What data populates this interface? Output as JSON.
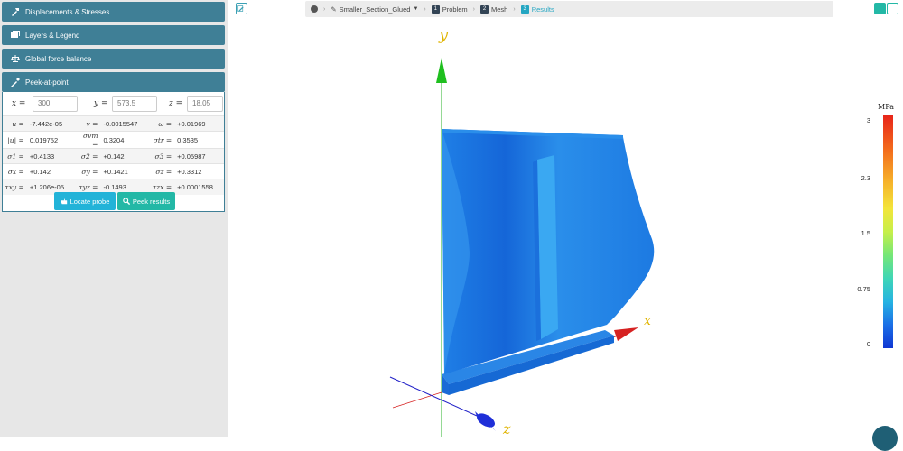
{
  "sidebar": {
    "panels": [
      {
        "label": "Displacements & Stresses",
        "icon": "hammer-icon"
      },
      {
        "label": "Layers & Legend",
        "icon": "image-icon"
      },
      {
        "label": "Global force balance",
        "icon": "scale-icon"
      },
      {
        "label": "Peek-at-point",
        "icon": "eyedropper-icon"
      }
    ],
    "peek": {
      "x_label": "x =",
      "x_value": "300",
      "y_label": "y =",
      "y_value": "573.5",
      "z_label": "z =",
      "z_value": "18.05",
      "rows": [
        [
          [
            "u =",
            "-7.442e-05"
          ],
          [
            "v =",
            "-0.0015547"
          ],
          [
            "ω =",
            "+0.01969"
          ]
        ],
        [
          [
            "|u| =",
            "0.019752"
          ],
          [
            "σvm =",
            "0.3204"
          ],
          [
            "σtr =",
            "0.3535"
          ]
        ],
        [
          [
            "σ1 =",
            "+0.4133"
          ],
          [
            "σ2 =",
            "+0.142"
          ],
          [
            "σ3 =",
            "+0.05987"
          ]
        ],
        [
          [
            "σx =",
            "+0.142"
          ],
          [
            "σy =",
            "+0.1421"
          ],
          [
            "σz =",
            "+0.3312"
          ]
        ],
        [
          [
            "τxy =",
            "+1.206e-05"
          ],
          [
            "τyz =",
            "-0.1493"
          ],
          [
            "τzx =",
            "+0.0001558"
          ]
        ]
      ],
      "locate_label": "Locate probe",
      "peek_label": "Peek results"
    }
  },
  "breadcrumb": {
    "project": "Smaller_Section_Glued",
    "steps": [
      {
        "num": "1",
        "label": "Problem"
      },
      {
        "num": "2",
        "label": "Mesh"
      },
      {
        "num": "3",
        "label": "Results"
      }
    ]
  },
  "legend": {
    "unit": "MPa",
    "ticks": [
      "3",
      "2.3",
      "1.5",
      "0.75",
      "0"
    ]
  },
  "axes": {
    "x": "x",
    "y": "y",
    "z": "z"
  },
  "colors": {
    "panel": "#3f7f96",
    "accent": "#25a6c2",
    "teal": "#23b8a6"
  }
}
